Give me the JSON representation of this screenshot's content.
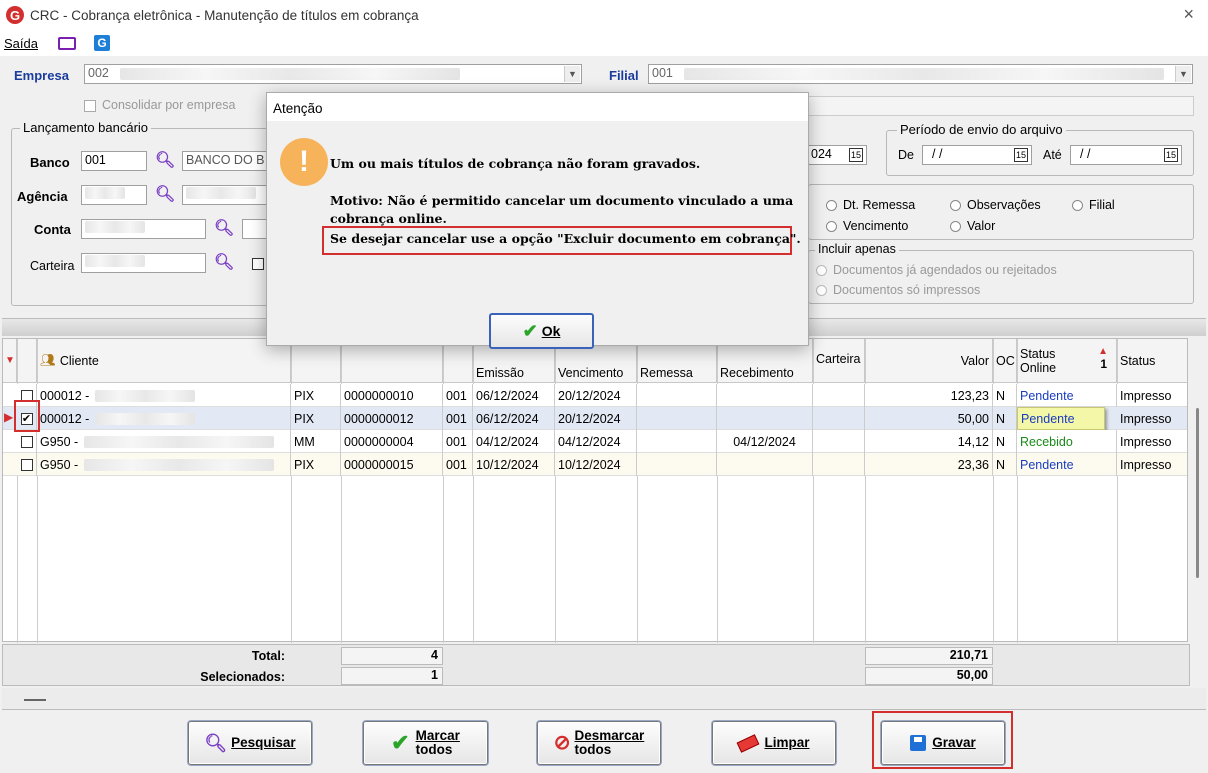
{
  "window": {
    "title": "CRC - Cobrança eletrônica - Manutenção de títulos em cobrança",
    "logo": "G",
    "close": "×"
  },
  "menu": {
    "saida": "Saída"
  },
  "form": {
    "empresa_label": "Empresa",
    "empresa_value": "002",
    "filial_label": "Filial",
    "filial_value": "001",
    "consolidar_label": "Consolidar por empresa",
    "lancamento_title": "Lançamento bancário",
    "banco_label": "Banco",
    "banco_value": "001",
    "banco_name": "BANCO DO B",
    "agencia_label": "Agência",
    "conta_label": "Conta",
    "carteira_label": "Carteira",
    "date_partial": "024",
    "periodo_title": "Período de envio do arquivo",
    "de_label": "De",
    "ate_label": "Até",
    "date_placeholder": "/ /",
    "cal_icon": "15",
    "order_options": [
      "Dt. Remessa",
      "Observações",
      "Filial",
      "Vencimento",
      "Valor"
    ],
    "incluir_title": "Incluir apenas",
    "incluir_options": [
      "Documentos já agendados ou rejeitados",
      "Documentos só impressos"
    ]
  },
  "grid": {
    "headers": {
      "cliente": "Cliente",
      "emissao": "Emissão",
      "vencimento": "Vencimento",
      "remessa": "Remessa",
      "recebimento": "Recebimento",
      "carteira": "Carteira",
      "valor": "Valor",
      "oc": "OC",
      "status_online_1": "Status",
      "status_online_2": "Online",
      "sort_index": "1",
      "status": "Status"
    },
    "rows": [
      {
        "checked": false,
        "cliente": "000012 -",
        "tipo": "PIX",
        "doc": "0000000010",
        "seq": "001",
        "emissao": "06/12/2024",
        "vencimento": "20/12/2024",
        "recebimento": "",
        "valor": "123,23",
        "oc": "N",
        "status_online": "Pendente",
        "status": "Impresso"
      },
      {
        "checked": true,
        "cliente": "000012 -",
        "tipo": "PIX",
        "doc": "0000000012",
        "seq": "001",
        "emissao": "06/12/2024",
        "vencimento": "20/12/2024",
        "recebimento": "",
        "valor": "50,00",
        "oc": "N",
        "status_online": "Pendente",
        "status": "Impresso"
      },
      {
        "checked": false,
        "cliente": "G950 -",
        "tipo": "MM",
        "doc": "0000000004",
        "seq": "001",
        "emissao": "04/12/2024",
        "vencimento": "04/12/2024",
        "recebimento": "04/12/2024",
        "valor": "14,12",
        "oc": "N",
        "status_online": "Recebido",
        "status": "Impresso"
      },
      {
        "checked": false,
        "cliente": "G950 -",
        "tipo": "PIX",
        "doc": "0000000015",
        "seq": "001",
        "emissao": "10/12/2024",
        "vencimento": "10/12/2024",
        "recebimento": "",
        "valor": "23,36",
        "oc": "N",
        "status_online": "Pendente",
        "status": "Impresso"
      }
    ],
    "total_label": "Total:",
    "total_count": "4",
    "total_value": "210,71",
    "sel_label": "Selecionados:",
    "sel_count": "1",
    "sel_value": "50,00"
  },
  "buttons": {
    "pesquisar": "Pesquisar",
    "marcar_1": "Marcar",
    "marcar_2": "todos",
    "desmarcar_1": "Desmarcar",
    "desmarcar_2": "todos",
    "limpar": "Limpar",
    "gravar": "Gravar"
  },
  "dialog": {
    "title": "Atenção",
    "line1": "Um ou mais títulos de cobrança não foram gravados.",
    "line2": "Motivo: Não é permitido cancelar um documento vinculado a uma",
    "line3": "cobrança online.",
    "line4": "Se desejar cancelar use a opção \"Excluir documento em cobrança\".",
    "ok": "Ok"
  },
  "colors": {
    "pendente": "#1a3cc0",
    "recebido": "#1a8a1a",
    "highlight": "#f5f7a8",
    "red": "#d32f2f",
    "accent": "#1a3c9c"
  }
}
